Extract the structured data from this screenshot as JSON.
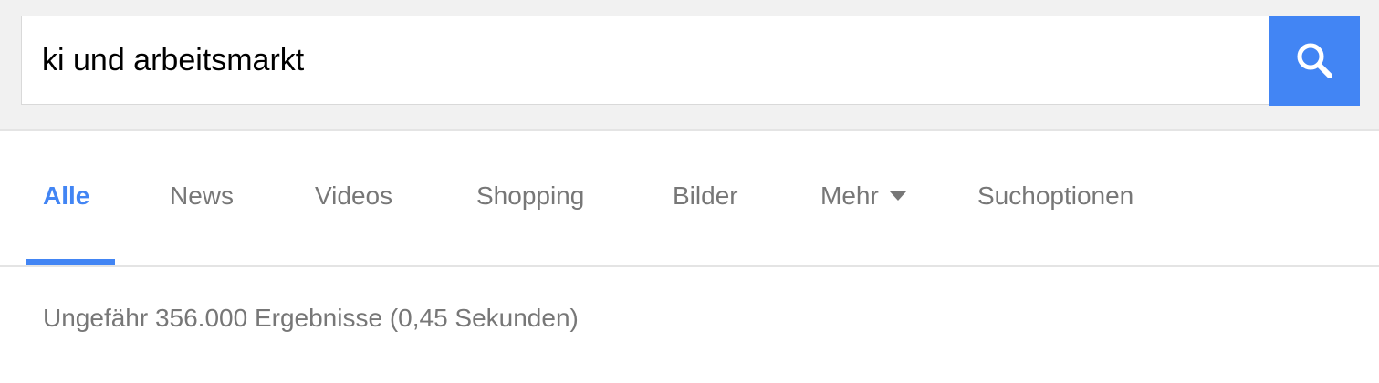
{
  "search": {
    "query": "ki und arbeitsmarkt",
    "button_icon": "search-icon",
    "button_color": "#4285f4"
  },
  "tabs": [
    {
      "label": "Alle",
      "active": true
    },
    {
      "label": "News",
      "active": false
    },
    {
      "label": "Videos",
      "active": false
    },
    {
      "label": "Shopping",
      "active": false
    },
    {
      "label": "Bilder",
      "active": false
    },
    {
      "label": "Mehr",
      "active": false,
      "icon": "dropdown-arrow-icon"
    },
    {
      "label": "Suchoptionen",
      "active": false
    }
  ],
  "results": {
    "stats": "Ungefähr 356.000 Ergebnisse (0,45 Sekunden)"
  },
  "colors": {
    "accent": "#4285f4",
    "tab_text": "#777777",
    "header_bg": "#f1f1f1"
  }
}
